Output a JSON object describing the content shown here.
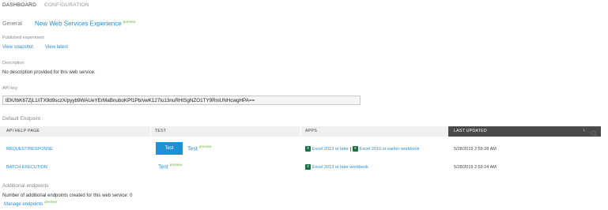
{
  "tabs": {
    "dashboard": "DASHBOARD",
    "configuration": "CONFIGURATION"
  },
  "header": {
    "section": "General",
    "service_name": "New Web Services Experience",
    "preview": "preview"
  },
  "published_experiment": {
    "label": "Published experiment",
    "view_snapshot": "View snapshot",
    "view_latest": "View latest"
  },
  "description": {
    "label": "Description",
    "text": "No description provided for this web service."
  },
  "api_key": {
    "label": "API key",
    "value": "tEK/IbK67ZjL1/iTX9d9sczX/pyyb9WAUeYErMaBnuboKPf1Pb/vwK127lu13nuRHtSgNZO1TY9RniUNHcwgHPA=="
  },
  "default_endpoint": {
    "title": "Default Endpoint",
    "columns": {
      "api_help_page": "API HELP PAGE",
      "test": "TEST",
      "apps": "APPS",
      "last_updated": "LAST UPDATED"
    },
    "sort_icon": "sort-down-arrow-icon",
    "search_icon": "search-icon",
    "rows": [
      {
        "api_help_page": "REQUEST/RESPONSE",
        "test_button": "Test",
        "test_link": "Test",
        "test_preview": "preview",
        "app1": "Excel 2013 or later",
        "app2": "Excel 2010 or earlier workbook",
        "last_updated": "5/28/2019 2:59:28 AM"
      },
      {
        "api_help_page": "BATCH EXECUTION",
        "test_link": "Test",
        "test_preview": "preview",
        "app1": "Excel 2013 or later workbook",
        "last_updated": "5/28/2019 2:59:24 AM"
      }
    ]
  },
  "additional_endpoints": {
    "title": "Additional endpoints",
    "count_text": "Number of additional endpoints created for this web service: 0",
    "manage_link": "Manage endpoints",
    "preview": "preview"
  },
  "colors": {
    "accent": "#1e90d6",
    "link": "#2a8dd4",
    "preview": "#6fb33a",
    "excel": "#1d7044"
  }
}
